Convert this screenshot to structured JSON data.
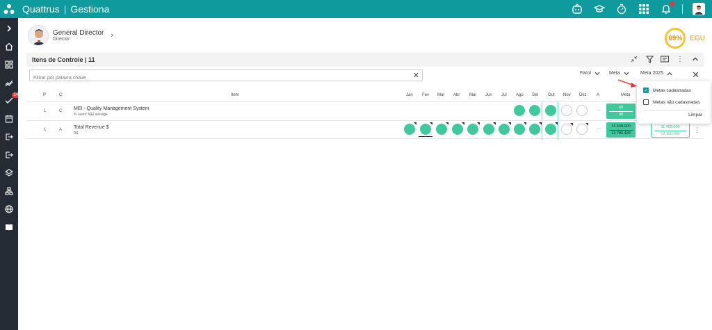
{
  "app": {
    "name": "Quattrus",
    "module": "Gestiona",
    "separator": "|"
  },
  "colors": {
    "topbar": "#0f9a9e",
    "sidebar": "#252b35",
    "green": "#3fc99c",
    "score": "#f2c437"
  },
  "sidebar": {
    "badge": "24"
  },
  "user": {
    "name": "General Director",
    "role": "Director"
  },
  "score": {
    "value": "69%",
    "label": "EGU"
  },
  "panel": {
    "title": "Itens de Controle | 11"
  },
  "filter": {
    "placeholder": "Filtrar por palavra chave",
    "dropdowns": [
      "Farol",
      "Meta",
      "Meta 2025"
    ]
  },
  "table": {
    "headers": {
      "p": "P",
      "c": "C",
      "item": "Item",
      "months": [
        "Jan",
        "Fev",
        "Mar",
        "Abr",
        "Mai",
        "Jun",
        "Jul",
        "Ago",
        "Set",
        "Out",
        "Nov",
        "Dez"
      ],
      "a": "A",
      "meta": "Meta"
    },
    "rows": [
      {
        "p": "1",
        "c": "C",
        "name": "MEI - Quality Management System",
        "sub": "% users' MEI average",
        "a": "—",
        "meta_top": "40",
        "meta_bottom": "40"
      },
      {
        "p": "1",
        "c": "A",
        "name": "Total Revenue $",
        "sub": "R$",
        "a": "—",
        "meta_top": "12.540.000",
        "meta_bottom": "12.786.428",
        "real_top": "11.493.000",
        "real_bottom": "12.100.000"
      }
    ]
  },
  "popup": {
    "option1": "Metas cadastradas",
    "option2": "Metas não cadastradas",
    "clear": "Limpar"
  }
}
